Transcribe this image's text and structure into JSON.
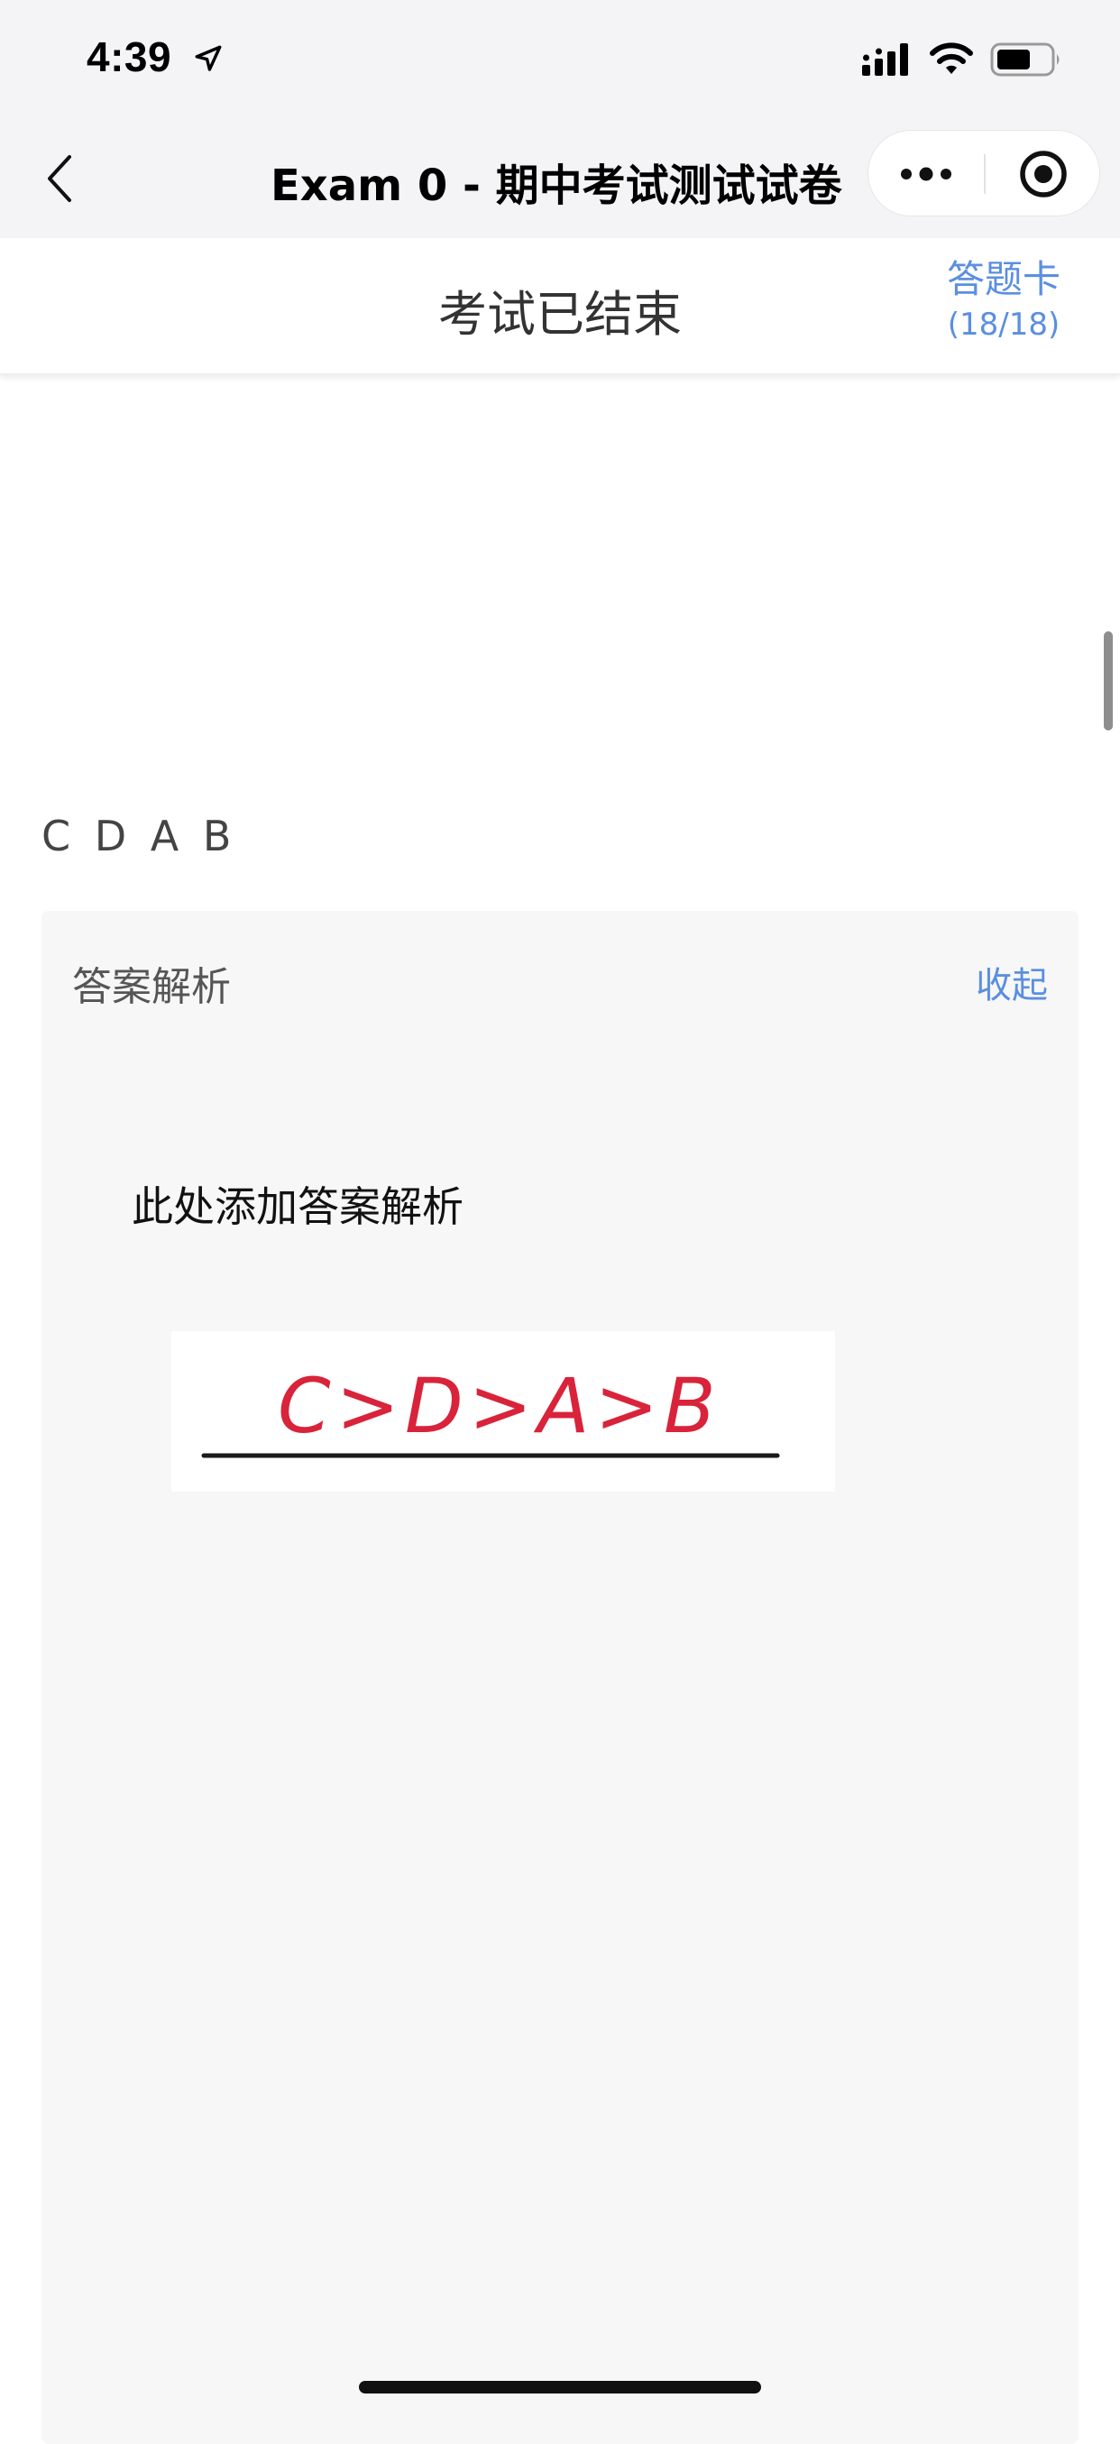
{
  "status_bar": {
    "time": "4:39",
    "location_icon": "location-arrow-icon",
    "signal_icon": "cellular-signal-icon",
    "wifi_icon": "wifi-icon",
    "battery_icon": "battery-icon"
  },
  "nav": {
    "back_icon": "chevron-left-icon",
    "title": "Exam 0 - 期中考试测试试卷",
    "more_icon": "more-dots-icon",
    "close_icon": "target-circle-icon"
  },
  "exam_header": {
    "status": "考试已结束",
    "answer_card_label": "答题卡",
    "answer_card_count": "(18/18)"
  },
  "answer": {
    "text": "C D A B"
  },
  "analysis": {
    "title": "答案解析",
    "collapse_label": "收起",
    "body": "此处添加答案解析",
    "image_text": "C>D>A>B"
  },
  "colors": {
    "accent": "#5b8fe0",
    "bar_background": "#f4f4f6",
    "panel_background": "#f7f7f7",
    "handwriting": "#d9233a"
  }
}
